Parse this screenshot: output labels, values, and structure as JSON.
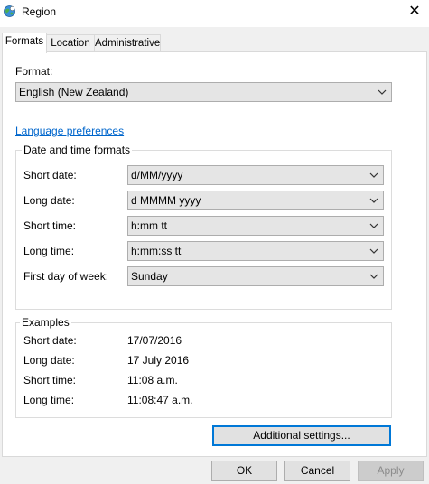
{
  "window": {
    "title": "Region",
    "close_glyph": "✕"
  },
  "tabs": [
    {
      "label": "Formats",
      "active": true
    },
    {
      "label": "Location",
      "active": false
    },
    {
      "label": "Administrative",
      "active": false
    }
  ],
  "format": {
    "label": "Format:",
    "value": "English (New Zealand)"
  },
  "language_link": "Language preferences",
  "datetime_group": {
    "title": "Date and time formats",
    "short_date": {
      "label": "Short date:",
      "value": "d/MM/yyyy"
    },
    "long_date": {
      "label": "Long date:",
      "value": "d MMMM yyyy"
    },
    "short_time": {
      "label": "Short time:",
      "value": "h:mm tt"
    },
    "long_time": {
      "label": "Long time:",
      "value": "h:mm:ss tt"
    },
    "first_day": {
      "label": "First day of week:",
      "value": "Sunday"
    }
  },
  "examples": {
    "title": "Examples",
    "short_date": {
      "label": "Short date:",
      "value": "17/07/2016"
    },
    "long_date": {
      "label": "Long date:",
      "value": "17 July 2016"
    },
    "short_time": {
      "label": "Short time:",
      "value": "11:08 a.m."
    },
    "long_time": {
      "label": "Long time:",
      "value": "11:08:47 a.m."
    }
  },
  "buttons": {
    "additional": "Additional settings...",
    "ok": "OK",
    "cancel": "Cancel",
    "apply": "Apply"
  },
  "icons": {
    "app": "globe-clock-icon",
    "close": "close-icon",
    "dropdown": "chevron-down-icon"
  },
  "colors": {
    "link": "#0066cc",
    "focus": "#0078d7"
  }
}
